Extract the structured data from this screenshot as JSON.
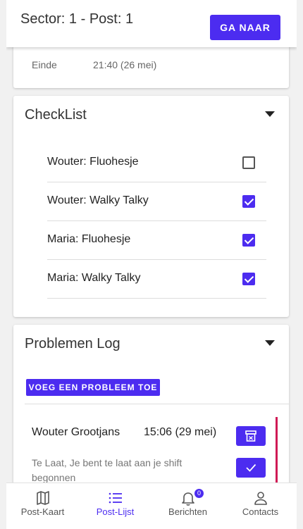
{
  "header": {
    "title": "Sector: 1 - Post: 1",
    "goto_label": "Ga naar"
  },
  "info": {
    "label": "Einde",
    "value": "21:40 (26 mei)"
  },
  "checklist": {
    "title": "CheckList",
    "items": [
      {
        "label": "Wouter: Fluohesje",
        "checked": false
      },
      {
        "label": "Wouter: Walky Talky",
        "checked": true
      },
      {
        "label": "Maria: Fluohesje",
        "checked": true
      },
      {
        "label": "Maria: Walky Talky",
        "checked": true
      }
    ]
  },
  "problems": {
    "title": "Problemen Log",
    "add_label": "VOEG EEN PROBLEEM TOE",
    "entries": [
      {
        "name": "Wouter Grootjans",
        "time": "15:06 (29 mei)",
        "description": "Te Laat, Je bent te laat aan je shift begonnen"
      }
    ]
  },
  "nav": {
    "items": [
      {
        "label": "Post-Kaart",
        "icon": "map-icon",
        "active": false
      },
      {
        "label": "Post-Lijst",
        "icon": "list-icon",
        "active": true
      },
      {
        "label": "Berichten",
        "icon": "bell-icon",
        "active": false,
        "badge": "0"
      },
      {
        "label": "Contacts",
        "icon": "person-icon",
        "active": false
      }
    ]
  },
  "colors": {
    "accent": "#4c2cf0",
    "alert": "#d01a55"
  }
}
